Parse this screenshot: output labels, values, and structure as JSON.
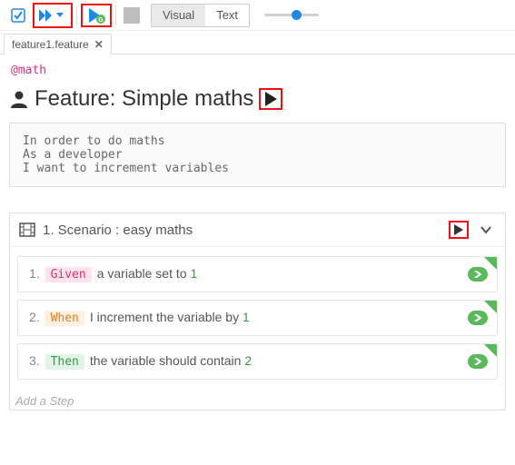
{
  "toolbar": {
    "viewTabs": {
      "visual": "Visual",
      "text": "Text"
    }
  },
  "tab": {
    "filename": "feature1.feature"
  },
  "tag": "@math",
  "feature": {
    "title": "Feature: Simple maths",
    "description": "In order to do maths\nAs a developer\nI want to increment variables"
  },
  "scenario": {
    "title": "1. Scenario : easy maths",
    "steps": [
      {
        "num": "1.",
        "keyword": "Given",
        "kwClass": "given",
        "textBefore": "a variable set to ",
        "arg": "1"
      },
      {
        "num": "2.",
        "keyword": "When",
        "kwClass": "when",
        "textBefore": "I increment the variable by ",
        "arg": "1"
      },
      {
        "num": "3.",
        "keyword": "Then",
        "kwClass": "then",
        "textBefore": "the variable should contain ",
        "arg": "2"
      }
    ],
    "addStep": "Add a Step"
  }
}
